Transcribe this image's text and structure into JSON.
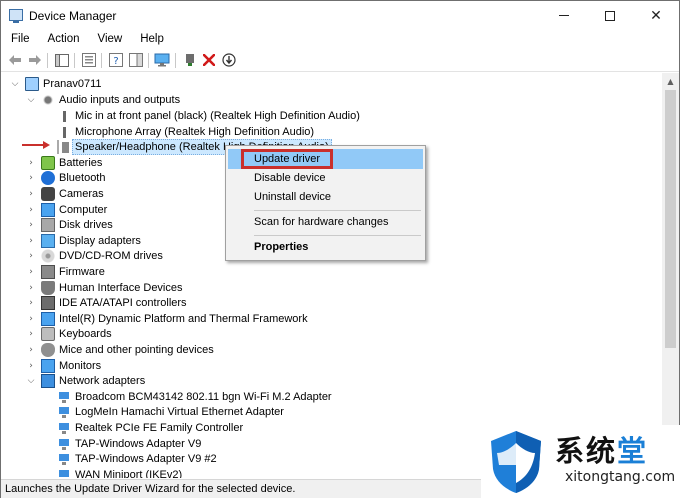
{
  "window": {
    "title": "Device Manager",
    "controls": {
      "minimize": "—",
      "maximize": "☐",
      "close": "✕"
    }
  },
  "menubar": [
    "File",
    "Action",
    "View",
    "Help"
  ],
  "toolbar": {
    "icons": [
      "back-icon",
      "forward-icon",
      "show-hide-tree-icon",
      "properties-icon",
      "help-icon",
      "action-pane-icon",
      "monitor-icon",
      "update-driver-icon",
      "uninstall-icon",
      "scan-hardware-icon"
    ],
    "uninstall_color": "#d11a1a"
  },
  "tree": {
    "root": "Pranav0711",
    "items": [
      {
        "label": "Audio inputs and outputs",
        "level": 1,
        "expanded": true,
        "icon": "audio-icon"
      },
      {
        "label": "Mic in at front panel (black) (Realtek High Definition Audio)",
        "level": 2,
        "icon": "microphone-icon"
      },
      {
        "label": "Microphone Array (Realtek High Definition Audio)",
        "level": 2,
        "icon": "microphone-icon"
      },
      {
        "label": "Speaker/Headphone (Realtek High Definition Audio)",
        "level": 2,
        "icon": "speaker-icon",
        "selected": true
      },
      {
        "label": "Batteries",
        "level": 1,
        "icon": "battery-icon"
      },
      {
        "label": "Bluetooth",
        "level": 1,
        "icon": "bluetooth-icon"
      },
      {
        "label": "Cameras",
        "level": 1,
        "icon": "camera-icon"
      },
      {
        "label": "Computer",
        "level": 1,
        "icon": "computer-icon"
      },
      {
        "label": "Disk drives",
        "level": 1,
        "icon": "disk-drive-icon"
      },
      {
        "label": "Display adapters",
        "level": 1,
        "icon": "display-adapter-icon"
      },
      {
        "label": "DVD/CD-ROM drives",
        "level": 1,
        "icon": "dvd-icon"
      },
      {
        "label": "Firmware",
        "level": 1,
        "icon": "firmware-icon"
      },
      {
        "label": "Human Interface Devices",
        "level": 1,
        "icon": "hid-icon"
      },
      {
        "label": "IDE ATA/ATAPI controllers",
        "level": 1,
        "icon": "ide-controller-icon"
      },
      {
        "label": "Intel(R) Dynamic Platform and Thermal Framework",
        "level": 1,
        "icon": "intel-framework-icon"
      },
      {
        "label": "Keyboards",
        "level": 1,
        "icon": "keyboard-icon"
      },
      {
        "label": "Mice and other pointing devices",
        "level": 1,
        "icon": "mouse-icon"
      },
      {
        "label": "Monitors",
        "level": 1,
        "icon": "monitor-icon"
      },
      {
        "label": "Network adapters",
        "level": 1,
        "expanded": true,
        "icon": "network-adapter-icon"
      },
      {
        "label": "Broadcom BCM43142 802.11 bgn Wi-Fi M.2 Adapter",
        "level": 2,
        "icon": "network-card-icon"
      },
      {
        "label": "LogMeIn Hamachi Virtual Ethernet Adapter",
        "level": 2,
        "icon": "network-card-icon"
      },
      {
        "label": "Realtek PCIe FE Family Controller",
        "level": 2,
        "icon": "network-card-icon"
      },
      {
        "label": "TAP-Windows Adapter V9",
        "level": 2,
        "icon": "network-card-icon"
      },
      {
        "label": "TAP-Windows Adapter V9 #2",
        "level": 2,
        "icon": "network-card-icon"
      },
      {
        "label": "WAN Miniport (IKEv2)",
        "level": 2,
        "icon": "network-card-icon"
      }
    ]
  },
  "context_menu": {
    "items": [
      {
        "label": "Update driver",
        "highlighted": true
      },
      {
        "label": "Disable device"
      },
      {
        "label": "Uninstall device"
      },
      {
        "label": "Scan for hardware changes"
      },
      {
        "label": "Properties",
        "bold": true
      }
    ],
    "highlight_color": "#91c9f7",
    "callout_color": "#c9302c"
  },
  "status_bar": {
    "text": "Launches the Update Driver Wizard for the selected device."
  },
  "watermark": {
    "title_part1": "系统",
    "title_part2": "堂",
    "url": "xitongtang.com"
  }
}
